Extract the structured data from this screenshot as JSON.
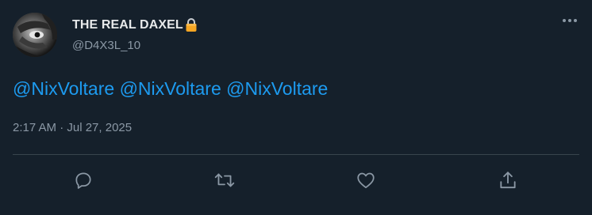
{
  "tweet": {
    "author": {
      "display_name": "THE REAL DAXEL",
      "handle": "@D4X3L_10",
      "lock_icon": "lock-icon",
      "avatar_icon": "avatar"
    },
    "mentions": [
      "@NixVoltare",
      "@NixVoltare",
      "@NixVoltare"
    ],
    "timestamp": "2:17 AM · Jul 27, 2025",
    "more_icon": "more-icon",
    "actions": [
      {
        "name": "reply",
        "icon": "reply-icon"
      },
      {
        "name": "retweet",
        "icon": "retweet-icon"
      },
      {
        "name": "like",
        "icon": "heart-icon"
      },
      {
        "name": "share",
        "icon": "share-icon"
      }
    ]
  },
  "colors": {
    "background": "#15202b",
    "mention": "#1d9bf0",
    "secondary_text": "#8b98a5",
    "lock": "#f5a623"
  }
}
